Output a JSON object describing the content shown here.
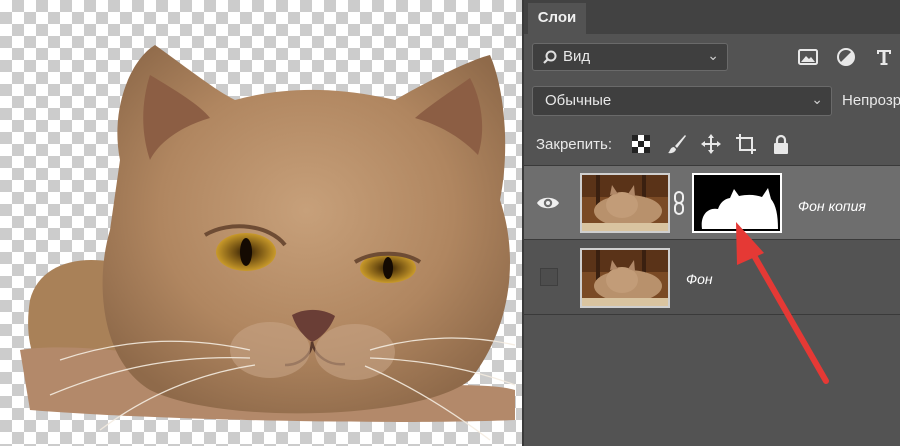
{
  "panel": {
    "tab_label": "Слои",
    "filter": {
      "kind_label": "Вид",
      "icons": [
        "image-filter-icon",
        "adjustment-filter-icon",
        "type-filter-icon"
      ]
    },
    "blend_mode": "Обычные",
    "opacity_label": "Непрозр",
    "lock": {
      "label": "Закрепить:",
      "icons": [
        "lock-transparent-pixels-icon",
        "lock-image-pixels-icon",
        "lock-position-icon",
        "lock-artboard-icon",
        "lock-all-icon"
      ]
    },
    "layers": [
      {
        "name": "Фон копия",
        "visible": true,
        "selected": true,
        "has_mask": true
      },
      {
        "name": "Фон",
        "visible": false,
        "selected": false,
        "has_mask": false
      }
    ]
  },
  "annotation": {
    "arrow_color": "#e53935"
  }
}
